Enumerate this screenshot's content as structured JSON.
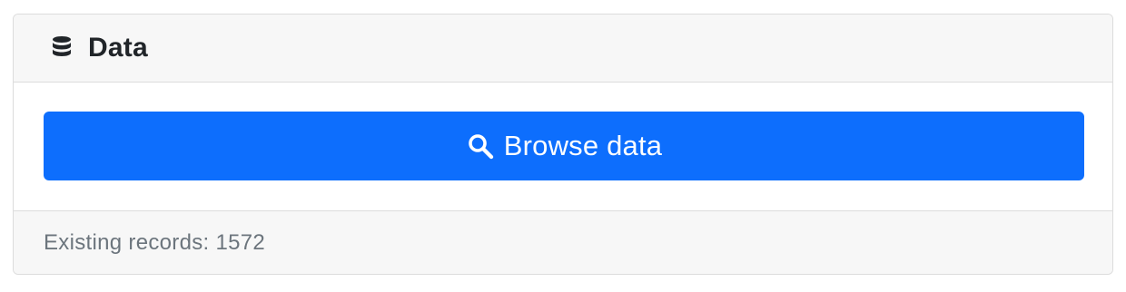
{
  "card": {
    "icon": "database-icon",
    "title": "Data"
  },
  "actions": {
    "browse_button": {
      "icon": "search-icon",
      "label": "Browse data"
    }
  },
  "footer": {
    "text": "Existing records: 1572"
  },
  "colors": {
    "primary": "#0d6efd",
    "header_bg": "#f7f7f7",
    "border": "#dcdcdc",
    "text_dark": "#212529",
    "text_muted": "#6c757d"
  }
}
